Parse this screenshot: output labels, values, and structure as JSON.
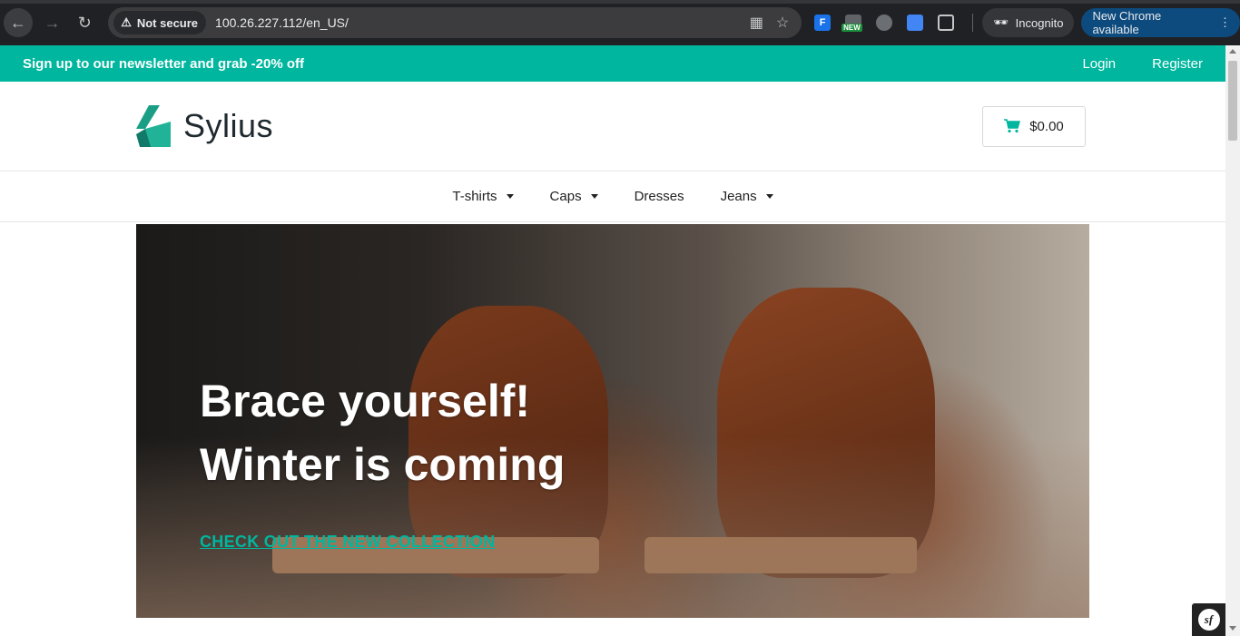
{
  "browser": {
    "security_label": "Not secure",
    "url": "100.26.227.112/en_US/",
    "new_badge": "NEW",
    "incognito_label": "Incognito",
    "update_label": "New Chrome available"
  },
  "topbar": {
    "promo": "Sign up to our newsletter and grab -20% off",
    "login": "Login",
    "register": "Register",
    "color": "#00b69e"
  },
  "header": {
    "logo_text": "Sylius",
    "cart_total": "$0.00"
  },
  "menu": {
    "items": [
      {
        "label": "T-shirts",
        "has_dropdown": true
      },
      {
        "label": "Caps",
        "has_dropdown": true
      },
      {
        "label": "Dresses",
        "has_dropdown": false
      },
      {
        "label": "Jeans",
        "has_dropdown": true
      }
    ]
  },
  "hero": {
    "title_line1": "Brace yourself!",
    "title_line2": "Winter is coming",
    "cta": "CHECK OUT THE NEW COLLECTION",
    "accent": "#00b69e"
  },
  "icons": {
    "back": "arrow-left-icon",
    "forward": "arrow-right-icon",
    "reload": "reload-icon",
    "warning": "warning-icon",
    "qr": "qr-code-icon",
    "bookmark": "star-icon",
    "extensions": "puzzle-icon",
    "cart": "cart-icon",
    "symfony": "symfony-icon"
  }
}
